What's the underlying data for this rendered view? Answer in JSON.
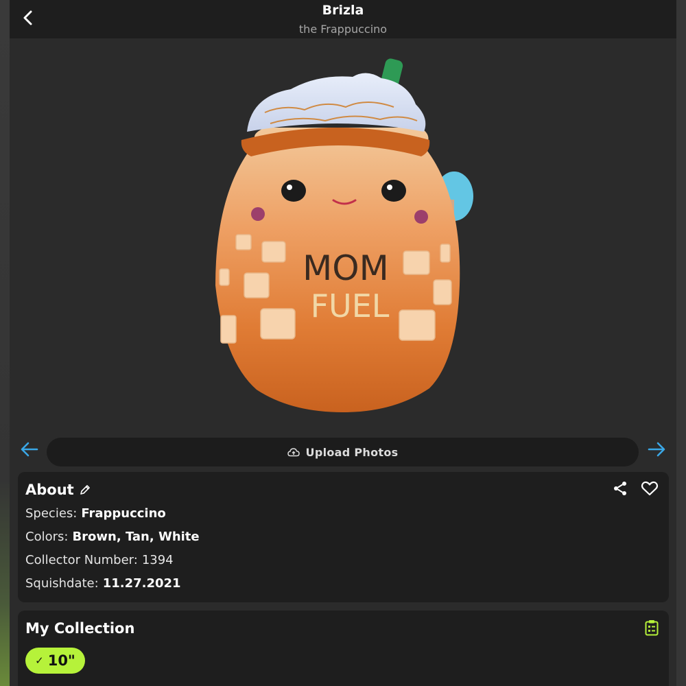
{
  "header": {
    "title": "Brizla",
    "subtitle": "the Frappuccino"
  },
  "product_image": {
    "text_line_1": "MOM",
    "text_line_2": "FUEL"
  },
  "upload": {
    "label": "Upload Photos"
  },
  "about": {
    "title": "About",
    "fields": [
      {
        "label": "Species:",
        "value": "Frappuccino"
      },
      {
        "label": "Colors:",
        "value": "Brown, Tan, White"
      },
      {
        "label": "Collector Number:",
        "value": "1394"
      },
      {
        "label": "Squishdate:",
        "value": "11.27.2021"
      }
    ]
  },
  "collection": {
    "title": "My Collection",
    "chip_check": "✓",
    "chip_size": "10\""
  },
  "icons": {
    "back": "chevron-left-icon",
    "prev": "arrow-left-icon",
    "next": "arrow-right-icon",
    "upload": "cloud-upload-icon",
    "edit": "pencil-icon",
    "share": "share-icon",
    "favorite": "heart-icon",
    "checklist": "clipboard-icon"
  },
  "colors": {
    "accent_green": "#b6f23a",
    "arrow_blue": "#3aa7e6",
    "card_bg": "#1e1e1e",
    "page_bg": "#2b2b2b"
  }
}
